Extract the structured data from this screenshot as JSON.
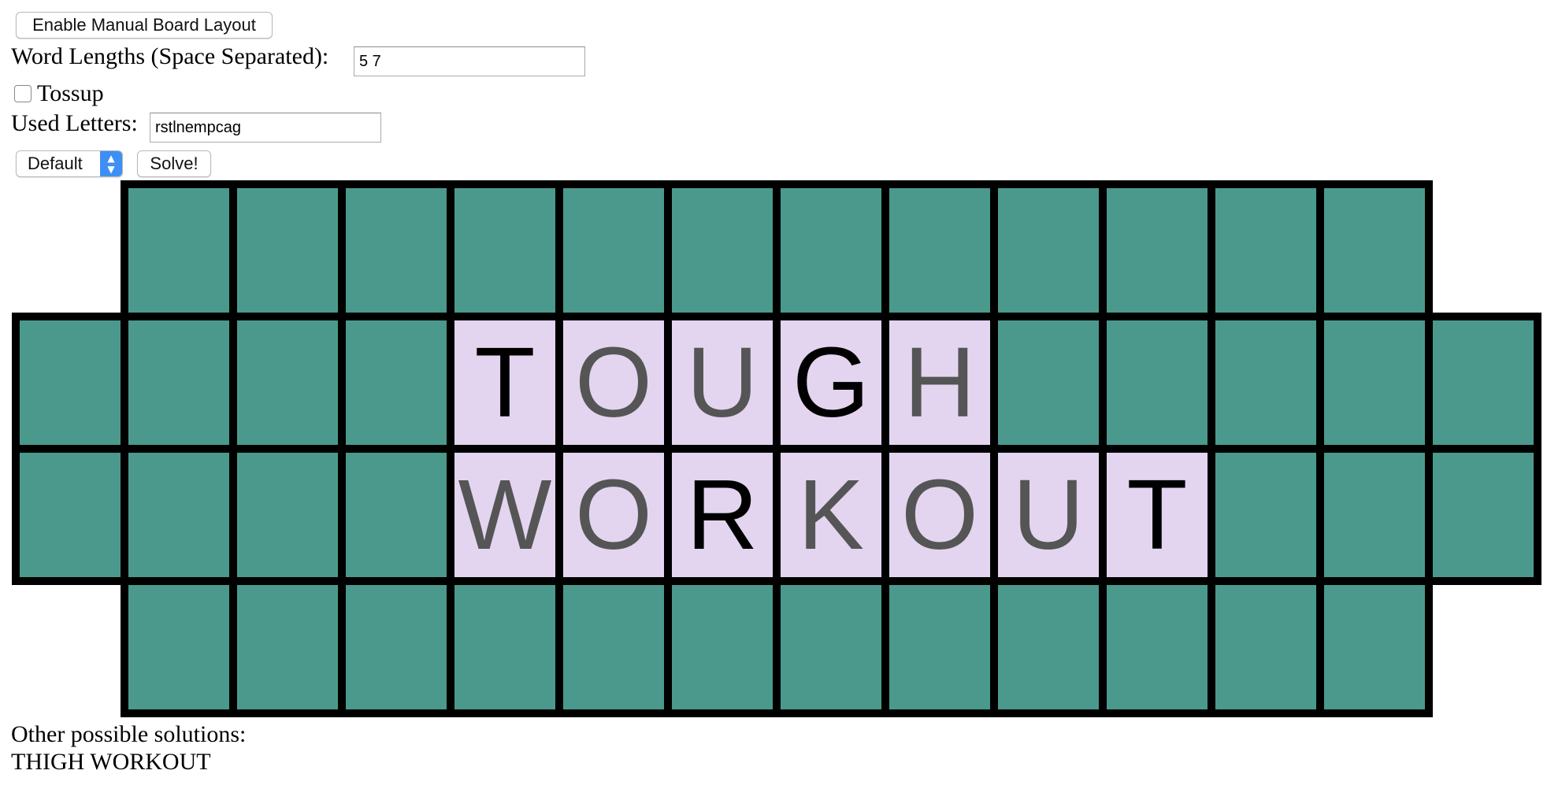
{
  "controls": {
    "manual_layout_button": "Enable Manual Board Layout",
    "word_lengths_label": "Word Lengths (Space Separated):",
    "word_lengths_value": "5 7",
    "tossup_label": "Tossup",
    "tossup_checked": false,
    "used_letters_label": "Used Letters:",
    "used_letters_value": "rstlnempcag",
    "mode_select_value": "Default",
    "solve_button": "Solve!"
  },
  "board": {
    "colors": {
      "empty_tile": "#4a998c",
      "letter_tile": "#e3d5f0",
      "grid": "#000000",
      "revealed_letter": "#000000",
      "solved_letter": "#555555"
    },
    "rows": [
      {
        "cells": 12,
        "tiles": []
      },
      {
        "cells": 14,
        "tiles": [
          {
            "col": 4,
            "letter": "T",
            "state": "revealed"
          },
          {
            "col": 5,
            "letter": "O",
            "state": "solved"
          },
          {
            "col": 6,
            "letter": "U",
            "state": "solved"
          },
          {
            "col": 7,
            "letter": "G",
            "state": "revealed"
          },
          {
            "col": 8,
            "letter": "H",
            "state": "solved"
          }
        ]
      },
      {
        "cells": 14,
        "tiles": [
          {
            "col": 4,
            "letter": "W",
            "state": "solved"
          },
          {
            "col": 5,
            "letter": "O",
            "state": "solved"
          },
          {
            "col": 6,
            "letter": "R",
            "state": "revealed"
          },
          {
            "col": 7,
            "letter": "K",
            "state": "solved"
          },
          {
            "col": 8,
            "letter": "O",
            "state": "solved"
          },
          {
            "col": 9,
            "letter": "U",
            "state": "solved"
          },
          {
            "col": 10,
            "letter": "T",
            "state": "revealed"
          }
        ]
      },
      {
        "cells": 12,
        "tiles": []
      }
    ]
  },
  "results": {
    "heading": "Other possible solutions:",
    "solutions": [
      "THIGH WORKOUT"
    ]
  }
}
